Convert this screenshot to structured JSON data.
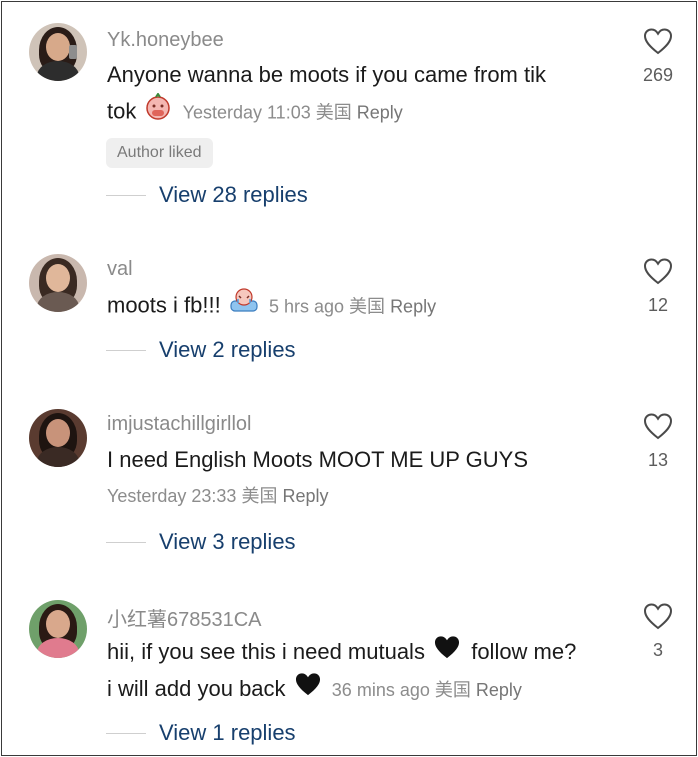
{
  "comments": [
    {
      "username": "Yk.honeybee",
      "text_line1": "Anyone wanna be moots if you came from tik",
      "text_line2": "tok",
      "emoji": "face-with-hand-over-mouth-icon",
      "time": "Yesterday 11:03",
      "region": "美国",
      "reply": "Reply",
      "badge": "Author liked",
      "view_replies": "View 28 replies",
      "likes": "269"
    },
    {
      "username": "val",
      "text_line1": "moots i fb!!!",
      "emoji": "crying-in-bathtub-icon",
      "time": "5 hrs ago",
      "region": "美国",
      "reply": "Reply",
      "view_replies": "View 2 replies",
      "likes": "12"
    },
    {
      "username": "imjustachillgirllol",
      "text_line1": "I need English Moots MOOT ME UP GUYS",
      "time": "Yesterday 23:33",
      "region": "美国",
      "reply": "Reply",
      "view_replies": "View 3 replies",
      "likes": "13"
    },
    {
      "username": "小红薯678531CA",
      "text_line1": "hii, if you see this i need mutuals",
      "text_line1b": "follow me?",
      "text_line2": "i will add you back",
      "emoji": "black-heart-icon",
      "time": "36 mins ago",
      "region": "美国",
      "reply": "Reply",
      "view_replies": "View 1 replies",
      "likes": "3"
    }
  ],
  "colors": {
    "link": "#173f6d",
    "meta": "#8c8c8c",
    "text": "#1b1b1b"
  }
}
